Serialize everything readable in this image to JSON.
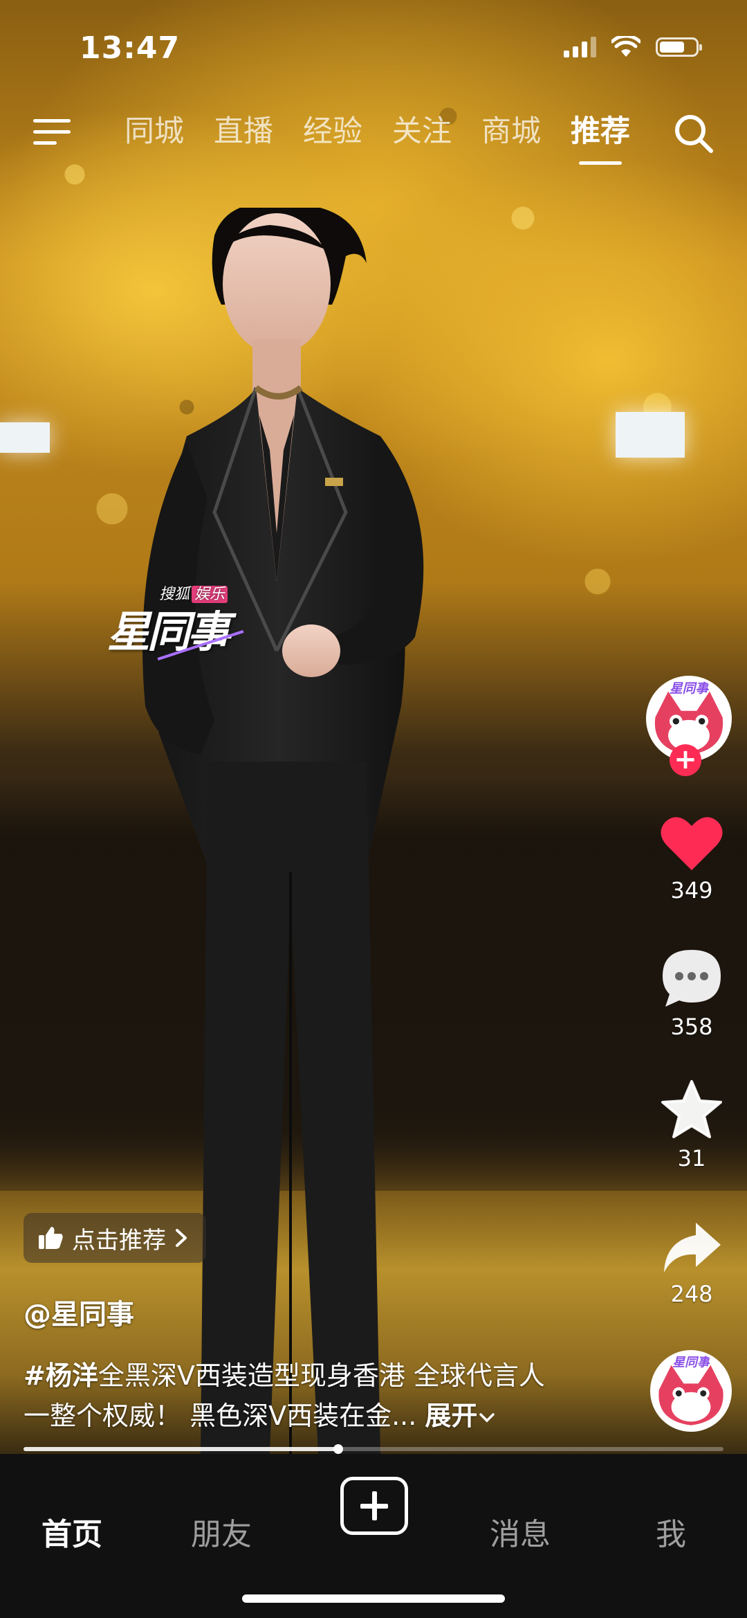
{
  "status_bar": {
    "time": "13:47",
    "battery_level": 0.7,
    "signal_bars_active": 3,
    "signal_bars_total": 4
  },
  "top_nav": {
    "menu_icon": "hamburger-menu-icon",
    "tabs": [
      {
        "label": "同城",
        "active": false
      },
      {
        "label": "直播",
        "active": false
      },
      {
        "label": "经验",
        "active": false
      },
      {
        "label": "关注",
        "active": false
      },
      {
        "label": "商城",
        "active": false
      },
      {
        "label": "推荐",
        "active": true
      }
    ],
    "search_icon": "search-icon"
  },
  "watermark": {
    "sub": "搜狐",
    "sub_badge": "娱乐",
    "main": "星同事"
  },
  "rail": {
    "like_count": "349",
    "comment_count": "358",
    "favorite_count": "31",
    "share_count": "248",
    "colors": {
      "like": "#fe2c55",
      "follow": "#fe2c55"
    }
  },
  "video_info": {
    "recommend_label": "点击推荐",
    "author": "@星同事",
    "caption_tag": "#杨洋",
    "caption_text": "全黑深V西装造型现身香港 全球代言人一整个权威！ 黑色深V西装在金...",
    "expand_label": "展开",
    "progress": 0.45
  },
  "bottom_nav": {
    "items": [
      {
        "label": "首页",
        "active": true
      },
      {
        "label": "朋友",
        "active": false
      },
      {
        "label": "消息",
        "active": false
      },
      {
        "label": "我",
        "active": false
      }
    ],
    "add_icon": "plus-icon"
  }
}
